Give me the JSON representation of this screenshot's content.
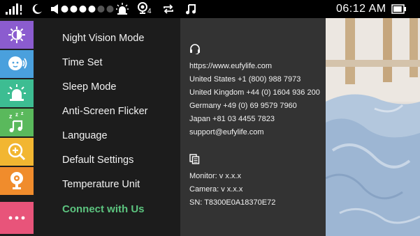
{
  "status_bar": {
    "time": "06:12 AM",
    "camera_badge": "4",
    "icons": [
      "signal-icon",
      "moon-icon",
      "volume-icon",
      "volume-level-dots",
      "alarm-icon",
      "camera-icon",
      "repeat-icon",
      "music-note-icon",
      "battery-icon"
    ],
    "volume_level_filled": 4,
    "volume_level_total": 6,
    "battery_level": 0.9
  },
  "sidebar": {
    "items": [
      {
        "name": "brightness",
        "icon": "brightness-icon",
        "color": "#8b5ccf"
      },
      {
        "name": "talk",
        "icon": "baby-talk-icon",
        "color": "#4aa0dd"
      },
      {
        "name": "alarm",
        "icon": "alarm-icon",
        "color": "#3dbd92"
      },
      {
        "name": "lullaby",
        "icon": "lullaby-music-icon",
        "color": "#5ab95c"
      },
      {
        "name": "zoom",
        "icon": "zoom-icon",
        "color": "#f2b631"
      },
      {
        "name": "camera",
        "icon": "camera-icon",
        "color": "#f08c2c"
      },
      {
        "name": "more",
        "icon": "more-dots-icon",
        "color": "#e8547a"
      }
    ]
  },
  "menu": {
    "items": [
      {
        "label": "Night Vision Mode"
      },
      {
        "label": "Time Set"
      },
      {
        "label": "Sleep Mode"
      },
      {
        "label": "Anti-Screen Flicker"
      },
      {
        "label": "Language"
      },
      {
        "label": "Default Settings"
      },
      {
        "label": "Temperature Unit"
      },
      {
        "label": "Connect with Us",
        "active": true
      }
    ],
    "active_color": "#5cc47f"
  },
  "contact": {
    "support_icon": "headset-icon",
    "lines": [
      "https://www.eufylife.com",
      "United States +1 (800) 988 7973",
      "United Kingdom +44 (0) 1604 936 200",
      "Germany +49 (0) 69 9579 7960",
      "Japan +81 03 4455 7823",
      "support@eufylife.com"
    ],
    "version_icon": "copy-icon",
    "version_lines": [
      "Monitor: v x.x.x",
      "Camera: v x.x.x",
      "SN: T8300E0A18370E72"
    ]
  }
}
